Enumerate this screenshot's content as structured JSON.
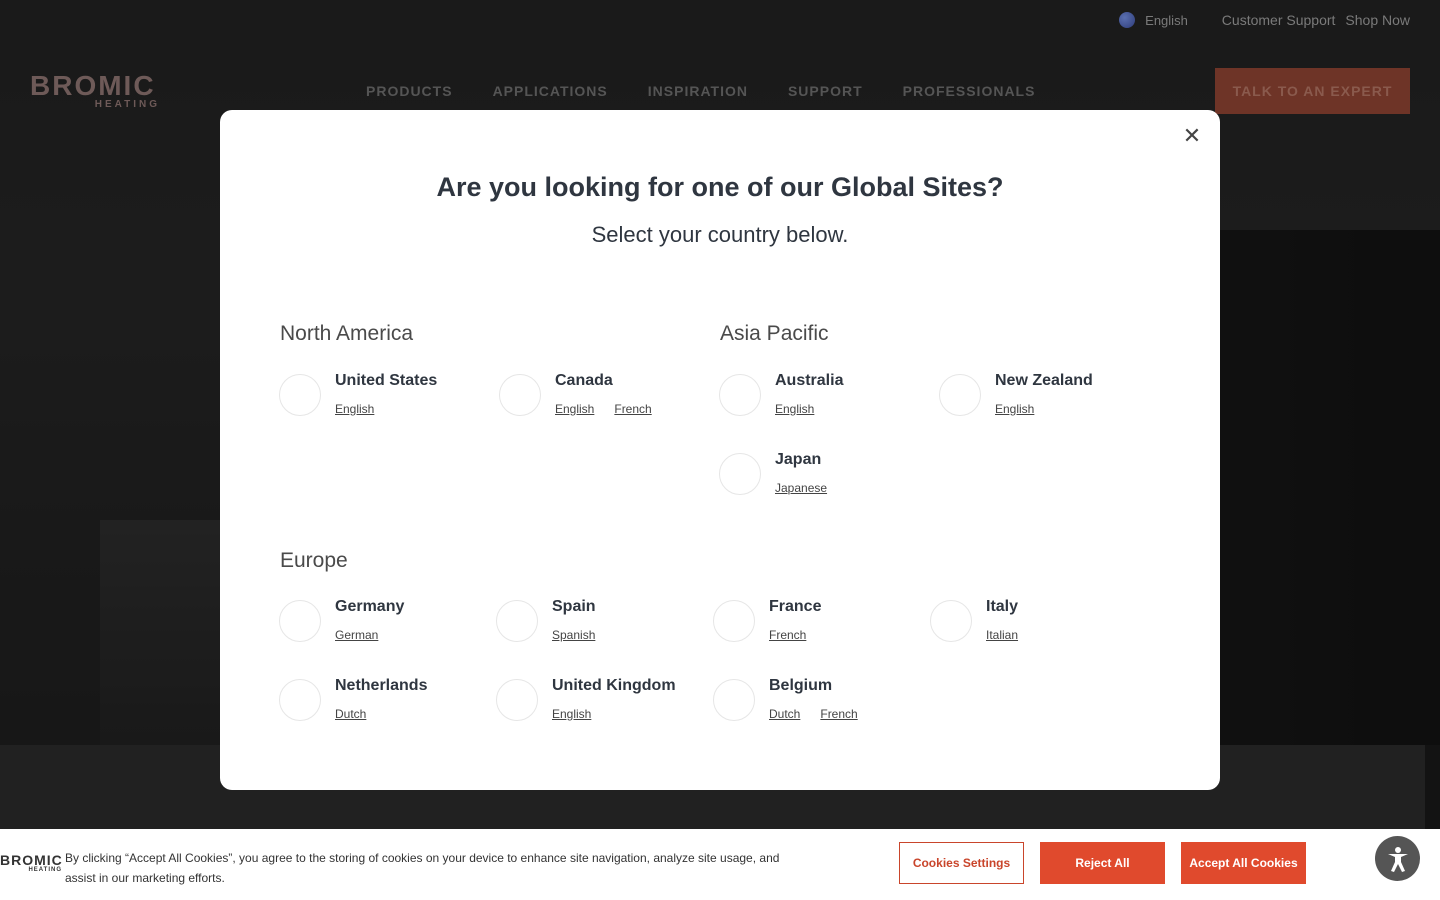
{
  "utility": {
    "language": "English",
    "support": "Customer Support",
    "shop": "Shop Now"
  },
  "nav": {
    "logo_main": "BROMIC",
    "logo_sub": "HEATING",
    "items": [
      "PRODUCTS",
      "APPLICATIONS",
      "INSPIRATION",
      "SUPPORT",
      "PROFESSIONALS"
    ],
    "cta": "TALK TO AN EXPERT"
  },
  "modal": {
    "title": "Are you looking for one of our Global Sites?",
    "subtitle": "Select your country below.",
    "regions": [
      {
        "name": "North America",
        "countries": [
          {
            "name": "United States",
            "langs": [
              "English"
            ]
          },
          {
            "name": "Canada",
            "langs": [
              "English",
              "French"
            ]
          }
        ]
      },
      {
        "name": "Asia Pacific",
        "countries": [
          {
            "name": "Australia",
            "langs": [
              "English"
            ]
          },
          {
            "name": "New Zealand",
            "langs": [
              "English"
            ]
          },
          {
            "name": "Japan",
            "langs": [
              "Japanese"
            ]
          }
        ]
      },
      {
        "name": "Europe",
        "countries": [
          {
            "name": "Germany",
            "langs": [
              "German"
            ]
          },
          {
            "name": "Spain",
            "langs": [
              "Spanish"
            ]
          },
          {
            "name": "France",
            "langs": [
              "French"
            ]
          },
          {
            "name": "Italy",
            "langs": [
              "Italian"
            ]
          },
          {
            "name": "Netherlands",
            "langs": [
              "Dutch"
            ]
          },
          {
            "name": "United Kingdom",
            "langs": [
              "English"
            ]
          },
          {
            "name": "Belgium",
            "langs": [
              "Dutch",
              "French"
            ]
          }
        ]
      }
    ]
  },
  "cookie": {
    "logo_main": "BROMIC",
    "logo_sub": "HEATING",
    "message": "By clicking “Accept All Cookies”, you agree to the storing of cookies on your device to enhance site navigation, analyze site usage, and assist in our marketing efforts.",
    "settings": "Cookies Settings",
    "reject": "Reject All",
    "accept": "Accept All Cookies"
  },
  "colors": {
    "accent": "#e04a2d",
    "text_dark": "#2f3640"
  }
}
